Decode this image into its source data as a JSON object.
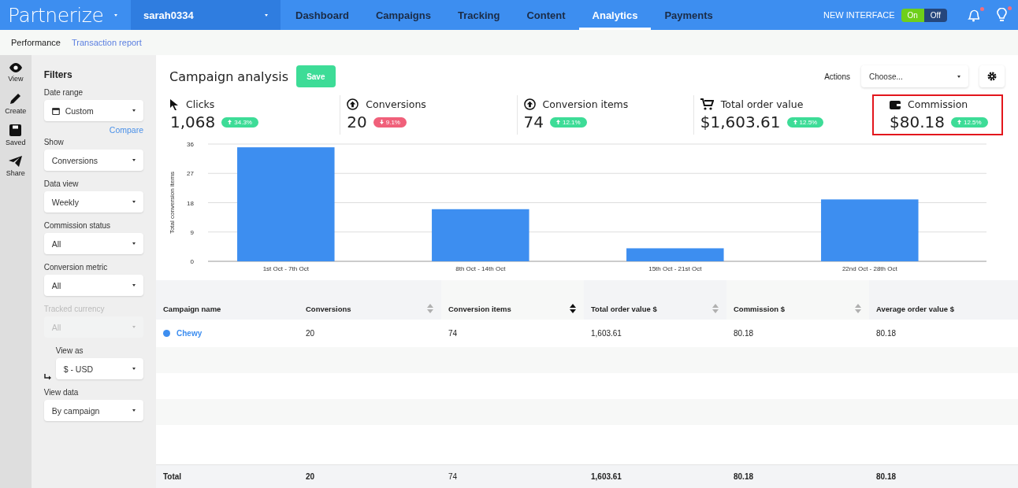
{
  "topbar": {
    "logo": "Partnerize",
    "account": "sarah0334",
    "nav": [
      {
        "label": "Dashboard",
        "selected": false
      },
      {
        "label": "Campaigns",
        "selected": false
      },
      {
        "label": "Tracking",
        "selected": false
      },
      {
        "label": "Content",
        "selected": false
      },
      {
        "label": "Analytics",
        "selected": true
      },
      {
        "label": "Payments",
        "selected": false
      }
    ],
    "new_interface": {
      "label": "NEW INTERFACE",
      "options": [
        {
          "label": "On",
          "selected": true
        },
        {
          "label": "Off",
          "selected": false
        }
      ]
    },
    "notifications_dot": true,
    "tips_dot": true
  },
  "subnav": [
    {
      "label": "Performance",
      "selected": true
    },
    {
      "label": "Transaction report",
      "selected": false
    }
  ],
  "rail": [
    {
      "label": "View"
    },
    {
      "label": "Create"
    },
    {
      "label": "Saved"
    },
    {
      "label": "Share"
    }
  ],
  "filters": {
    "title": "Filters",
    "items": [
      {
        "kind": "date",
        "label": "Date range",
        "value": "Custom",
        "disabled": false,
        "link": "Compare"
      },
      {
        "kind": "select",
        "label": "Show",
        "value": "Conversions",
        "disabled": false
      },
      {
        "kind": "select",
        "label": "Data view",
        "value": "Weekly",
        "disabled": false
      },
      {
        "kind": "select",
        "label": "Commission status",
        "value": "All",
        "disabled": false
      },
      {
        "kind": "select",
        "label": "Conversion metric",
        "value": "All",
        "disabled": false
      },
      {
        "kind": "select",
        "label": "Tracked currency",
        "value": "All",
        "disabled": true
      },
      {
        "kind": "sub",
        "label": "View as",
        "value": "$ - USD",
        "disabled": false
      },
      {
        "kind": "select",
        "label": "View data",
        "value": "By campaign",
        "disabled": false
      }
    ]
  },
  "main": {
    "title": "Campaign analysis",
    "save": "Save",
    "actions_label": "Actions",
    "actions_placeholder": "Choose...",
    "metrics": [
      {
        "label": "Clicks",
        "value": "1,068",
        "change": "34.3%",
        "up": true,
        "highlighted": false
      },
      {
        "label": "Conversions",
        "value": "20",
        "change": "9.1%",
        "up": false,
        "highlighted": false
      },
      {
        "label": "Conversion items",
        "value": "74",
        "change": "12.1%",
        "up": true,
        "highlighted": false
      },
      {
        "label": "Total order value",
        "value": "$1,603.61",
        "change": "12.5%",
        "up": true,
        "highlighted": false
      },
      {
        "label": "Commission",
        "value": "$80.18",
        "change": "12.5%",
        "up": true,
        "highlighted": true
      }
    ],
    "chart_data": {
      "type": "bar",
      "ylabel": "Total conversion items",
      "categories": [
        "1st Oct - 7th Oct",
        "8th Oct - 14th Oct",
        "15th Oct - 21st Oct",
        "22nd Oct - 28th Oct"
      ],
      "series": [
        {
          "color": "#3d8ef0",
          "values": [
            35,
            16,
            4,
            19
          ]
        }
      ],
      "ylim": [
        0,
        36
      ],
      "yticks": [
        0,
        9,
        18,
        27,
        36
      ],
      "grid": true
    },
    "table": {
      "columns": [
        {
          "label": "Campaign name",
          "sortable": false
        },
        {
          "label": "Conversions",
          "sortable": true,
          "sorted": false
        },
        {
          "label": "Conversion items",
          "sortable": true,
          "sorted": true
        },
        {
          "label": "Total order value $",
          "sortable": true,
          "sorted": false
        },
        {
          "label": "Commission $",
          "sortable": true,
          "sorted": false
        },
        {
          "label": "Average order value $",
          "sortable": false
        }
      ],
      "rows": [
        {
          "color": "#3d8ef0",
          "cells": [
            "Chewy",
            "20",
            "74",
            "1,603.61",
            "80.18",
            "80.18"
          ]
        }
      ],
      "total": [
        "Total",
        "20",
        "74",
        "1,603.61",
        "80.18",
        "80.18"
      ]
    }
  }
}
